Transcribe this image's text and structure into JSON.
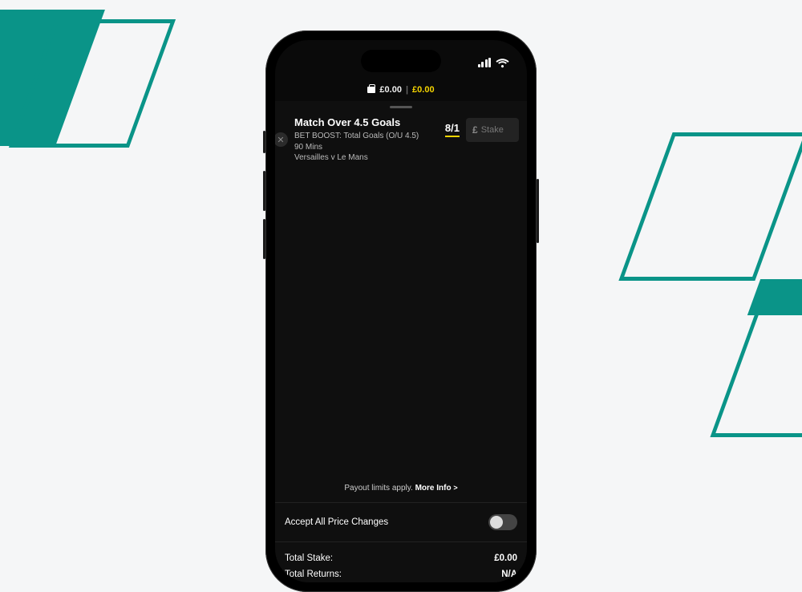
{
  "balance": {
    "cash": "£0.00",
    "bonus": "£0.00"
  },
  "bet": {
    "title": "Match Over 4.5 Goals",
    "market": "BET BOOST: Total Goals (O/U 4.5)",
    "period": "90 Mins",
    "event": "Versailles v Le Mans",
    "odds": "8/1",
    "stake_currency": "£",
    "stake_placeholder": "Stake"
  },
  "payout": {
    "notice": "Payout limits apply.",
    "more_label": "More Info",
    "chevron": ">"
  },
  "accept": {
    "label": "Accept All Price Changes",
    "enabled": false
  },
  "totals": {
    "stake_label": "Total Stake:",
    "stake_value": "£0.00",
    "returns_label": "Total Returns:",
    "returns_value": "N/A"
  }
}
